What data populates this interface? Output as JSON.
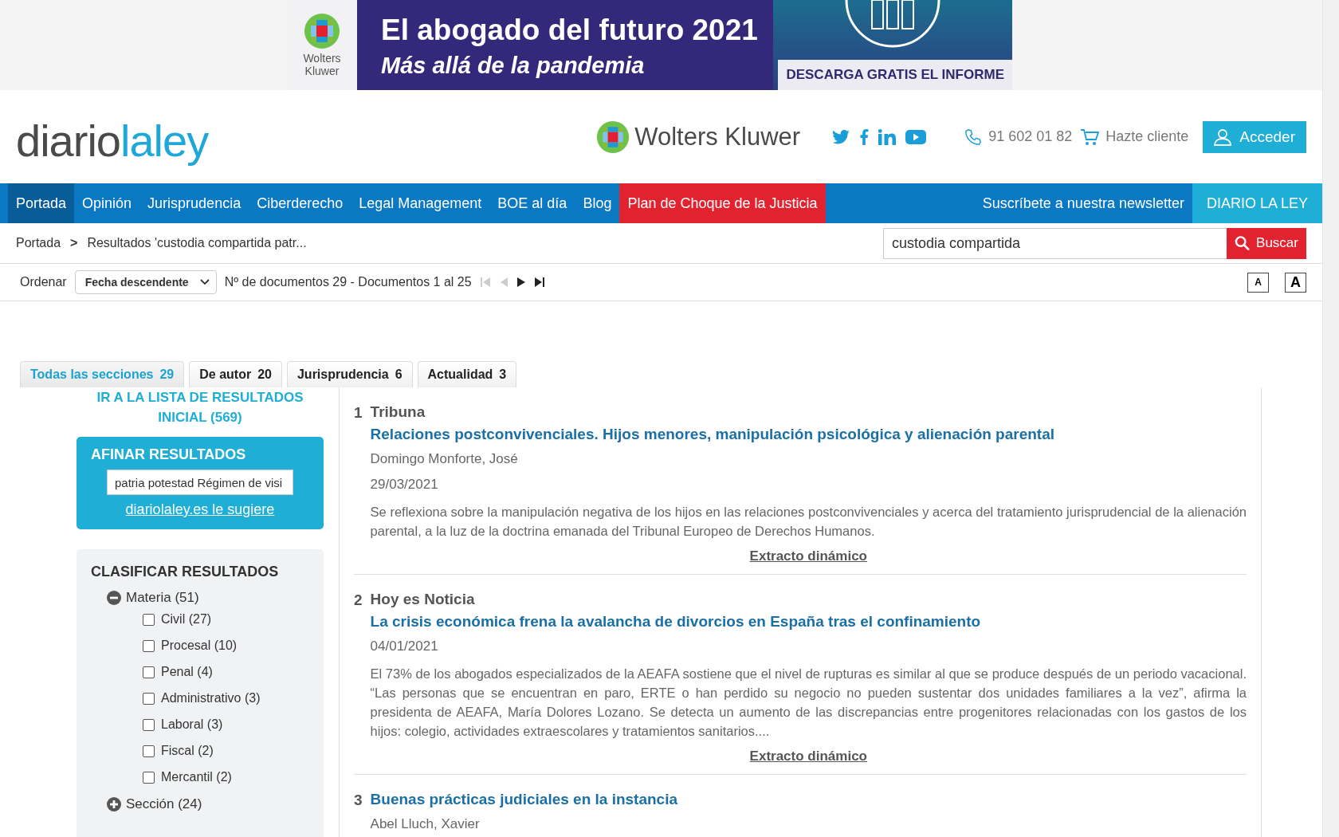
{
  "banner": {
    "logo_text": "Wolters Kluwer",
    "title": "El abogado del futuro 2021",
    "subtitle": "Más allá de la pandemia",
    "cta": "DESCARGA GRATIS EL INFORME"
  },
  "header": {
    "logo_parts": [
      "diario",
      "laley"
    ],
    "brand": "Wolters Kluwer",
    "phone": "91 602 01 82",
    "cart": "Hazte cliente",
    "login": "Acceder"
  },
  "nav": {
    "items": [
      {
        "label": "Portada",
        "selected": true,
        "kind": "normal"
      },
      {
        "label": "Opinión",
        "selected": false,
        "kind": "normal"
      },
      {
        "label": "Jurisprudencia",
        "selected": false,
        "kind": "normal"
      },
      {
        "label": "Ciberderecho",
        "selected": false,
        "kind": "normal"
      },
      {
        "label": "Legal Management",
        "selected": false,
        "kind": "normal"
      },
      {
        "label": "BOE al día",
        "selected": false,
        "kind": "normal"
      },
      {
        "label": "Blog",
        "selected": false,
        "kind": "normal"
      },
      {
        "label": "Plan de Choque de la Justicia",
        "selected": false,
        "kind": "highlight"
      }
    ],
    "newsletter": "Suscríbete a nuestra newsletter",
    "brand_button": "DIARIO LA LEY"
  },
  "breadcrumb": {
    "items": [
      "Portada",
      "Resultados 'custodia compartida patr..."
    ],
    "separator": ">"
  },
  "search": {
    "value": "custodia compartida",
    "button": "Buscar"
  },
  "sort": {
    "label": "Ordenar",
    "value": "Fecha descendente",
    "count": "Nº de documentos 29 - Documentos 1 al 25",
    "font_small": "A",
    "font_large": "A"
  },
  "tabs": [
    {
      "label": "Todas las secciones",
      "count": "29",
      "selected": true
    },
    {
      "label": "De autor",
      "count": "20",
      "selected": false
    },
    {
      "label": "Jurisprudencia",
      "count": "6",
      "selected": false
    },
    {
      "label": "Actualidad",
      "count": "3",
      "selected": false
    }
  ],
  "sidebar": {
    "initial_link": "IR A LA LISTA DE RESULTADOS INICIAL (569)",
    "refine": {
      "title": "AFINAR RESULTADOS",
      "value": "patria potestad Régimen de visi",
      "link": "diariolaley.es le sugiere"
    },
    "classify": {
      "title": "CLASIFICAR RESULTADOS",
      "groups": [
        {
          "label": "Materia (51)",
          "expanded": true,
          "children": [
            {
              "label": "Civil (27)",
              "checked": false
            },
            {
              "label": "Procesal (10)",
              "checked": false
            },
            {
              "label": "Penal (4)",
              "checked": false
            },
            {
              "label": "Administrativo (3)",
              "checked": false
            },
            {
              "label": "Laboral (3)",
              "checked": false
            },
            {
              "label": "Fiscal (2)",
              "checked": false
            },
            {
              "label": "Mercantil (2)",
              "checked": false
            }
          ]
        },
        {
          "label": "Sección (24)",
          "expanded": false
        }
      ]
    }
  },
  "results": [
    {
      "number": "1",
      "section": "Tribuna",
      "title": "Relaciones postconvivenciales. Hijos menores, manipulación psicológica y alienación parental",
      "author": "Domingo Monforte, José",
      "date": "29/03/2021",
      "summary": "Se reflexiona sobre la manipulación negativa de los hijos en las relaciones postconvivenciales y acerca del tratamiento jurisprudencial de la alienación parental, a la luz de la doctrina emanada del Tribunal Europeo de Derechos Humanos.",
      "link": "Extracto dinámico"
    },
    {
      "number": "2",
      "section": "Hoy es Noticia",
      "title": "La crisis económica frena la avalancha de divorcios en España tras el confinamiento",
      "date": "04/01/2021",
      "summary": "El 73% de los abogados especializados de la AEAFA sostiene que el nivel de rupturas es similar al que se produce después de un periodo vacacional. “Las personas que se encuentran en paro, ERTE o han perdido su negocio no pueden sustentar dos unidades familiares a la vez”, afirma la presidenta de AEAFA, María Dolores Lozano. Se detecta un aumento de las discrepancias entre progenitores relacionadas con los gastos de los hijos: colegio, actividades extraescolares y tratamientos sanitarios....",
      "link": "Extracto dinámico"
    },
    {
      "number": "3",
      "title": "Buenas prácticas judiciales en la instancia",
      "author": "Abel Lluch, Xavier"
    }
  ]
}
